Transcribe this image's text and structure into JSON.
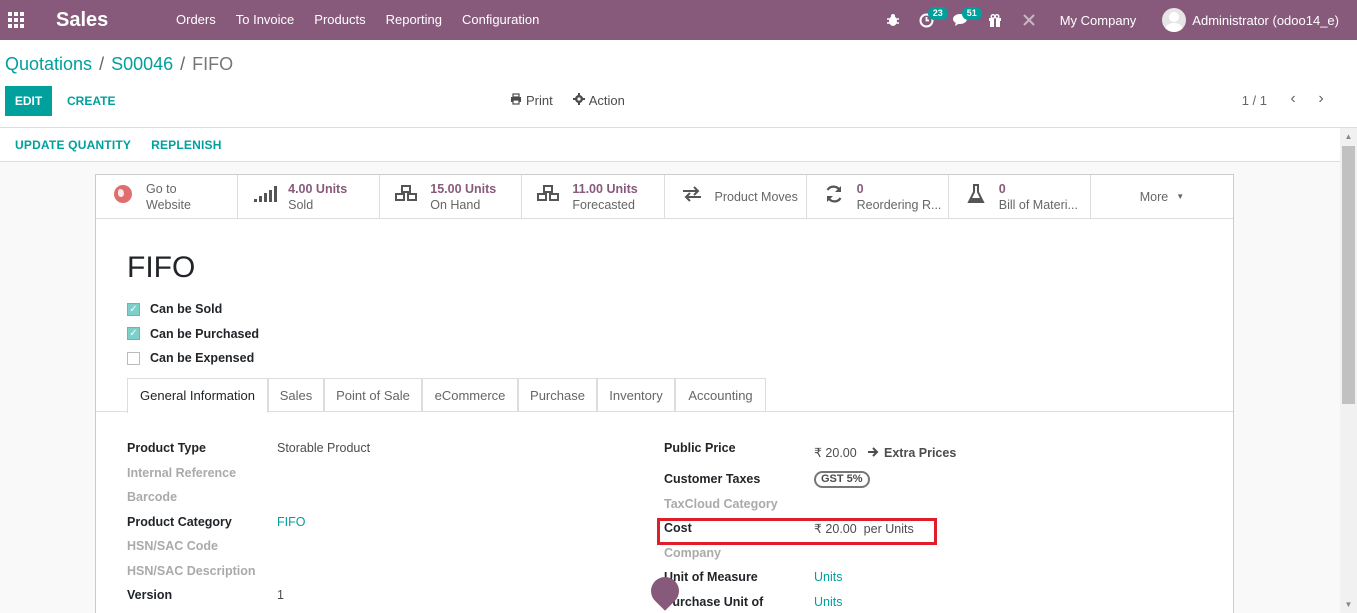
{
  "navbar": {
    "app_name": "Sales",
    "menu": [
      "Orders",
      "To Invoice",
      "Products",
      "Reporting",
      "Configuration"
    ],
    "activities_count": "23",
    "messages_count": "51",
    "company": "My Company",
    "user": "Administrator (odoo14_e)"
  },
  "breadcrumb": {
    "items": [
      "Quotations",
      "S00046"
    ],
    "current": "FIFO"
  },
  "toolbar": {
    "edit_label": "EDIT",
    "create_label": "CREATE",
    "print_label": "Print",
    "action_label": "Action",
    "pager": "1 / 1"
  },
  "statusbar": {
    "buttons": [
      "UPDATE QUANTITY",
      "REPLENISH"
    ]
  },
  "smart_buttons": {
    "website": {
      "line1": "Go to",
      "line2": "Website"
    },
    "sold": {
      "value": "4.00 Units",
      "label": "Sold"
    },
    "on_hand": {
      "value": "15.00 Units",
      "label": "On Hand"
    },
    "forecasted": {
      "value": "11.00 Units",
      "label": "Forecasted"
    },
    "moves": {
      "label": "Product Moves"
    },
    "reordering": {
      "value": "0",
      "label": "Reordering R..."
    },
    "bom": {
      "value": "0",
      "label": "Bill of Materi..."
    },
    "more": {
      "label": "More"
    }
  },
  "product": {
    "name": "FIFO",
    "flags": [
      {
        "label": "Can be Sold",
        "checked": true
      },
      {
        "label": "Can be Purchased",
        "checked": true
      },
      {
        "label": "Can be Expensed",
        "checked": false
      }
    ]
  },
  "tabs": [
    "General Information",
    "Sales",
    "Point of Sale",
    "eCommerce",
    "Purchase",
    "Inventory",
    "Accounting"
  ],
  "left_fields": {
    "product_type_label": "Product Type",
    "product_type": "Storable Product",
    "internal_ref_label": "Internal Reference",
    "barcode_label": "Barcode",
    "category_label": "Product Category",
    "category": "FIFO",
    "hsn_code_label": "HSN/SAC Code",
    "hsn_desc_label": "HSN/SAC Description",
    "version_label": "Version",
    "version": "1"
  },
  "right_fields": {
    "public_price_label": "Public Price",
    "public_price": "₹ 20.00",
    "extra_prices": "Extra Prices",
    "customer_taxes_label": "Customer Taxes",
    "customer_tax": "GST 5%",
    "taxcloud_label": "TaxCloud Category",
    "cost_label": "Cost",
    "cost": "₹ 20.00",
    "cost_unit": "per Units",
    "company_label": "Company",
    "uom_label": "Unit of Measure",
    "uom": "Units",
    "purchase_uom_label": "Purchase Unit of",
    "purchase_uom": "Units"
  }
}
